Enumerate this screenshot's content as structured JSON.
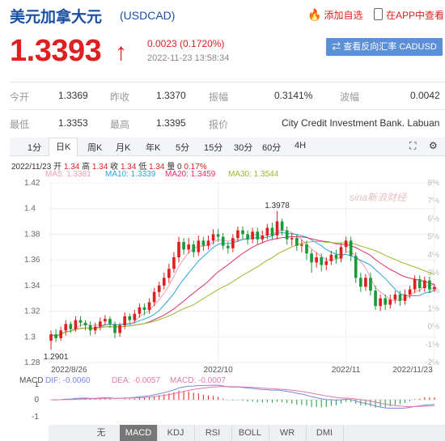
{
  "header": {
    "title": "美元加拿大元",
    "code": "(USDCAD)",
    "favorite": "添加自选",
    "app": "在APP中查看"
  },
  "quote": {
    "price": "1.3393",
    "arrow": "↑",
    "change": "0.0023 (0.1720%)",
    "time": "2022-11-23 13:58:34",
    "button": "⇄ 查看反向汇率 CADUSD"
  },
  "stats": [
    [
      {
        "l": "今开",
        "v": "1.3369"
      },
      {
        "l": "昨收",
        "v": "1.3370"
      },
      {
        "l": "振幅",
        "v": "0.3141%"
      },
      {
        "l": "波幅",
        "v": "0.0042"
      }
    ],
    [
      {
        "l": "最低",
        "v": "1.3353"
      },
      {
        "l": "最高",
        "v": "1.3395"
      },
      {
        "l": "报价",
        "v": "City Credit Investment Bank. Labuan"
      }
    ]
  ],
  "tabs": [
    "1分",
    "日K",
    "周K",
    "月K",
    "年K",
    "5分",
    "15分",
    "30分",
    "60分",
    "4H"
  ],
  "active_tab": "日K",
  "info": {
    "date": "2022/11/23",
    "open_l": "开",
    "open": "1.34",
    "high_l": "高",
    "high": "1.34",
    "close_l": "收",
    "close": "1.34",
    "low_l": "低",
    "low": "1.34",
    "vol_l": "量",
    "vol": "0",
    "pct": "0.17%"
  },
  "ma": [
    {
      "label": "MA5: 1.3381",
      "color": "#f19bb0"
    },
    {
      "label": "MA10: 1.3339",
      "color": "#2aa7d8"
    },
    {
      "label": "MA20: 1.3459",
      "color": "#e0306a"
    },
    {
      "label": "MA30: 1.3544",
      "color": "#9ab82c"
    }
  ],
  "macd": [
    {
      "label": "MACD",
      "color": "#555"
    },
    {
      "label": "DIF: -0.0060",
      "color": "#7a86e0"
    },
    {
      "label": "DEA: -0.0057",
      "color": "#e07aa6"
    },
    {
      "label": "MACD: -0.0007",
      "color": "#e07aa6"
    }
  ],
  "watermark": "sina新浪财经",
  "bottom_tabs": [
    "无",
    "MACD",
    "KDJ",
    "RSI",
    "BOLL",
    "WR",
    "DMI"
  ],
  "active_bottom": "MACD",
  "bottom_arrows": [
    "▲",
    "▼"
  ],
  "colors": {
    "up": "#e02020",
    "down": "#1a9a3a",
    "title": "#1a4fa0",
    "button": "#5b8fd8"
  },
  "chart_data": {
    "type": "candlestick",
    "ylim": [
      1.28,
      1.42
    ],
    "y_ticks": [
      "1.42",
      "1.4",
      "1.38",
      "1.36",
      "1.34",
      "1.32",
      "1.3",
      "1.28"
    ],
    "y2_ticks": [
      "8%",
      "7%",
      "6%",
      "5%",
      "4%",
      "3%",
      "2%",
      "1%",
      "0%",
      "-1%",
      "-2%"
    ],
    "x_labels": [
      "2022/8/26",
      "2022/10",
      "2022/11",
      "2022/11/23"
    ],
    "x_label_index": [
      0,
      34,
      60,
      78
    ],
    "annotations": [
      {
        "text": "1.3978",
        "index": 46,
        "value": 1.3978
      },
      {
        "text": "1.2901",
        "index": 1,
        "value": 1.2901
      }
    ],
    "candles": [
      [
        1.297,
        1.302,
        1.29,
        1.305
      ],
      [
        1.302,
        1.299,
        1.296,
        1.306
      ],
      [
        1.299,
        1.305,
        1.297,
        1.308
      ],
      [
        1.305,
        1.31,
        1.301,
        1.313
      ],
      [
        1.31,
        1.306,
        1.303,
        1.312
      ],
      [
        1.306,
        1.313,
        1.304,
        1.316
      ],
      [
        1.313,
        1.311,
        1.308,
        1.316
      ],
      [
        1.311,
        1.309,
        1.305,
        1.313
      ],
      [
        1.309,
        1.305,
        1.301,
        1.312
      ],
      [
        1.305,
        1.308,
        1.302,
        1.311
      ],
      [
        1.308,
        1.312,
        1.305,
        1.315
      ],
      [
        1.312,
        1.314,
        1.309,
        1.317
      ],
      [
        1.314,
        1.31,
        1.307,
        1.316
      ],
      [
        1.31,
        1.303,
        1.299,
        1.312
      ],
      [
        1.303,
        1.309,
        1.3,
        1.311
      ],
      [
        1.309,
        1.316,
        1.306,
        1.319
      ],
      [
        1.316,
        1.313,
        1.31,
        1.318
      ],
      [
        1.313,
        1.318,
        1.311,
        1.321
      ],
      [
        1.318,
        1.323,
        1.315,
        1.326
      ],
      [
        1.323,
        1.321,
        1.317,
        1.326
      ],
      [
        1.321,
        1.327,
        1.318,
        1.33
      ],
      [
        1.327,
        1.335,
        1.324,
        1.338
      ],
      [
        1.335,
        1.34,
        1.331,
        1.343
      ],
      [
        1.34,
        1.346,
        1.337,
        1.35
      ],
      [
        1.346,
        1.353,
        1.342,
        1.357
      ],
      [
        1.353,
        1.362,
        1.35,
        1.366
      ],
      [
        1.362,
        1.374,
        1.358,
        1.378
      ],
      [
        1.374,
        1.368,
        1.364,
        1.377
      ],
      [
        1.368,
        1.372,
        1.365,
        1.377
      ],
      [
        1.372,
        1.366,
        1.362,
        1.375
      ],
      [
        1.366,
        1.375,
        1.363,
        1.379
      ],
      [
        1.375,
        1.371,
        1.367,
        1.378
      ],
      [
        1.371,
        1.375,
        1.368,
        1.379
      ],
      [
        1.375,
        1.38,
        1.372,
        1.384
      ],
      [
        1.38,
        1.378,
        1.374,
        1.384
      ],
      [
        1.378,
        1.371,
        1.368,
        1.381
      ],
      [
        1.371,
        1.369,
        1.365,
        1.374
      ],
      [
        1.369,
        1.377,
        1.366,
        1.38
      ],
      [
        1.377,
        1.383,
        1.374,
        1.386
      ],
      [
        1.383,
        1.38,
        1.376,
        1.386
      ],
      [
        1.38,
        1.376,
        1.372,
        1.383
      ],
      [
        1.376,
        1.382,
        1.373,
        1.385
      ],
      [
        1.382,
        1.376,
        1.372,
        1.385
      ],
      [
        1.376,
        1.379,
        1.373,
        1.383
      ],
      [
        1.379,
        1.385,
        1.376,
        1.388
      ],
      [
        1.385,
        1.379,
        1.376,
        1.389
      ],
      [
        1.379,
        1.39,
        1.376,
        1.398
      ],
      [
        1.39,
        1.383,
        1.379,
        1.392
      ],
      [
        1.383,
        1.376,
        1.372,
        1.386
      ],
      [
        1.376,
        1.377,
        1.371,
        1.381
      ],
      [
        1.377,
        1.371,
        1.367,
        1.38
      ],
      [
        1.371,
        1.372,
        1.366,
        1.376
      ],
      [
        1.372,
        1.365,
        1.36,
        1.375
      ],
      [
        1.365,
        1.358,
        1.35,
        1.368
      ],
      [
        1.358,
        1.362,
        1.354,
        1.366
      ],
      [
        1.362,
        1.356,
        1.351,
        1.365
      ],
      [
        1.356,
        1.359,
        1.352,
        1.362
      ],
      [
        1.359,
        1.364,
        1.356,
        1.367
      ],
      [
        1.364,
        1.361,
        1.357,
        1.368
      ],
      [
        1.361,
        1.37,
        1.358,
        1.373
      ],
      [
        1.37,
        1.375,
        1.366,
        1.378
      ],
      [
        1.375,
        1.363,
        1.359,
        1.378
      ],
      [
        1.363,
        1.346,
        1.342,
        1.366
      ],
      [
        1.346,
        1.339,
        1.335,
        1.35
      ],
      [
        1.339,
        1.346,
        1.336,
        1.349
      ],
      [
        1.346,
        1.336,
        1.332,
        1.35
      ],
      [
        1.336,
        1.324,
        1.321,
        1.34
      ],
      [
        1.324,
        1.33,
        1.32,
        1.333
      ],
      [
        1.33,
        1.325,
        1.321,
        1.333
      ],
      [
        1.325,
        1.329,
        1.322,
        1.333
      ],
      [
        1.329,
        1.333,
        1.326,
        1.336
      ],
      [
        1.333,
        1.328,
        1.324,
        1.336
      ],
      [
        1.328,
        1.333,
        1.325,
        1.337
      ],
      [
        1.333,
        1.337,
        1.33,
        1.34
      ],
      [
        1.337,
        1.345,
        1.334,
        1.348
      ],
      [
        1.345,
        1.338,
        1.335,
        1.348
      ],
      [
        1.338,
        1.344,
        1.335,
        1.347
      ],
      [
        1.344,
        1.337,
        1.334,
        1.347
      ],
      [
        1.337,
        1.339,
        1.335,
        1.341
      ]
    ]
  }
}
